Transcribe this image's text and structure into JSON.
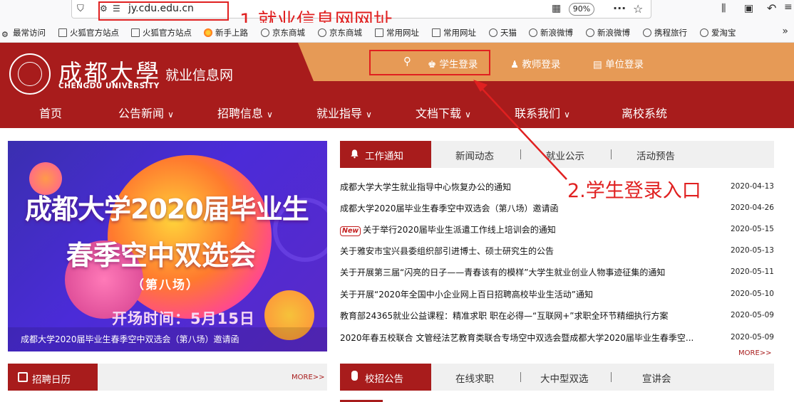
{
  "browser": {
    "url": "jy.cdu.edu.cn",
    "zoom": "90%"
  },
  "annotations": {
    "url_note": "1.就业信息网网址",
    "login_note": "2.学生登录入口"
  },
  "bookmarks": [
    "最常访问",
    "火狐官方站点",
    "火狐官方站点",
    "新手上路",
    "京东商城",
    "京东商城",
    "常用网址",
    "常用网址",
    "天猫",
    "新浪微博",
    "新浪微博",
    "携程旅行",
    "爱淘宝"
  ],
  "header": {
    "logo_cn": "成都大學",
    "logo_en": "CHENGDU UNIVERSITY",
    "subtitle": "就业信息网",
    "student_login": "学生登录",
    "teacher_login": "教师登录",
    "company_login": "单位登录"
  },
  "nav": [
    "首页",
    "公告新闻",
    "招聘信息",
    "就业指导",
    "文档下载",
    "联系我们",
    "离校系统"
  ],
  "banner": {
    "title1": "成都大学2020届毕业生",
    "title2": "春季空中双选会",
    "sub": "（第八场）",
    "time": "开场时间：5月15日",
    "caption": "成都大学2020届毕业生春季空中双选会（第八场）邀请函"
  },
  "news_tabs": [
    "工作通知",
    "新闻动态",
    "就业公示",
    "活动预告"
  ],
  "news": [
    {
      "title": "成都大学大学生就业指导中心恢复办公的通知",
      "date": "2020-04-13",
      "is_new": false
    },
    {
      "title": "成都大学2020届毕业生春季空中双选会（第八场）邀请函",
      "date": "2020-04-26",
      "is_new": false
    },
    {
      "title": "关于举行2020届毕业生派遣工作线上培训会的通知",
      "date": "2020-05-15",
      "is_new": true
    },
    {
      "title": "关于雅安市宝兴县委组织部引进博士、硕士研究生的公告",
      "date": "2020-05-13",
      "is_new": false
    },
    {
      "title": "关于开展第三届“闪亮的日子——青春该有的模样”大学生就业创业人物事迹征集的通知",
      "date": "2020-05-11",
      "is_new": false
    },
    {
      "title": "关于开展“2020年全国中小企业网上百日招聘高校毕业生活动”通知",
      "date": "2020-05-10",
      "is_new": false
    },
    {
      "title": "教育部24365就业公益课程：精准求职 职在必得—“互联网+”求职全环节精细执行方案",
      "date": "2020-05-09",
      "is_new": false
    },
    {
      "title": "2020年春五校联合 文管经法艺教育类联合专场空中双选会暨成都大学2020届毕业生春季空...",
      "date": "2020-05-09",
      "is_new": false
    }
  ],
  "new_badge": "New",
  "more": "MORE>>",
  "calendar": {
    "label": "招聘日历",
    "more": "MORE>>"
  },
  "bottom_tabs": [
    "校招公告",
    "在线求职",
    "大中型双选",
    "宣讲会"
  ],
  "colors": {
    "brand_red": "#a81c1c",
    "header_orange": "#e69a56",
    "annotation_red": "#e02020"
  }
}
